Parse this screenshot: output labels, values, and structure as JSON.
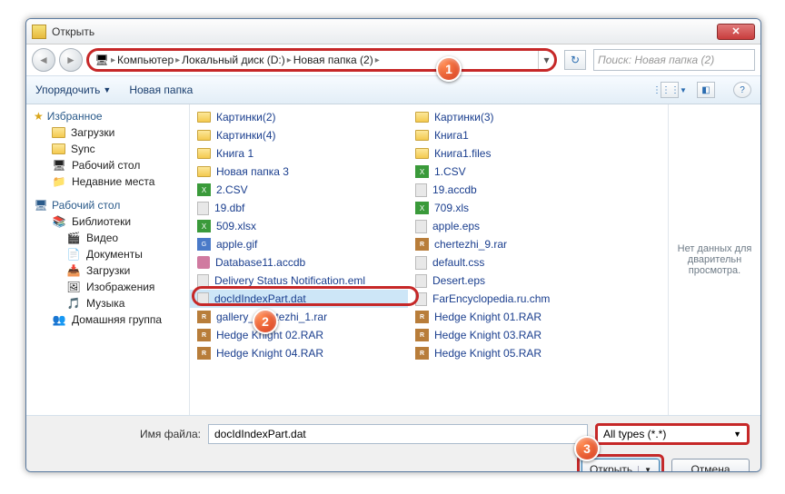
{
  "window": {
    "title": "Открыть"
  },
  "breadcrumb": [
    "Компьютер",
    "Локальный диск (D:)",
    "Новая папка (2)"
  ],
  "search": {
    "placeholder": "Поиск: Новая папка (2)"
  },
  "toolbar": {
    "organize": "Упорядочить",
    "newfolder": "Новая папка"
  },
  "sidebar": {
    "fav_header": "Избранное",
    "fav": [
      "Загрузки",
      "Sync",
      "Рабочий стол",
      "Недавние места"
    ],
    "desk_header": "Рабочий стол",
    "lib_header": "Библиотеки",
    "lib": [
      "Видео",
      "Документы",
      "Загрузки",
      "Изображения",
      "Музыка"
    ],
    "homegroup": "Домашняя группа"
  },
  "files": {
    "col1": [
      {
        "icon": "fld",
        "name": "Картинки(2)"
      },
      {
        "icon": "fld",
        "name": "Картинки(4)"
      },
      {
        "icon": "fld",
        "name": "Книга 1"
      },
      {
        "icon": "fld",
        "name": "Новая папка 3"
      },
      {
        "icon": "xls",
        "name": "2.CSV"
      },
      {
        "icon": "doc",
        "name": "19.dbf"
      },
      {
        "icon": "xls",
        "name": "509.xlsx"
      },
      {
        "icon": "gif",
        "name": "apple.gif"
      },
      {
        "icon": "db",
        "name": "Database11.accdb"
      },
      {
        "icon": "doc",
        "name": "Delivery Status Notification.eml"
      },
      {
        "icon": "doc",
        "name": "docIdIndexPart.dat",
        "selected": true
      },
      {
        "icon": "rar",
        "name": "gallery_chertezhi_1.rar"
      },
      {
        "icon": "rar",
        "name": "Hedge Knight 02.RAR"
      },
      {
        "icon": "rar",
        "name": "Hedge Knight 04.RAR"
      }
    ],
    "col2": [
      {
        "icon": "fld",
        "name": "Картинки(3)"
      },
      {
        "icon": "fld",
        "name": "Книга1"
      },
      {
        "icon": "fld",
        "name": "Книга1.files"
      },
      {
        "icon": "xls",
        "name": "1.CSV"
      },
      {
        "icon": "doc",
        "name": "19.accdb"
      },
      {
        "icon": "xls",
        "name": "709.xls"
      },
      {
        "icon": "doc",
        "name": "apple.eps"
      },
      {
        "icon": "rar",
        "name": "chertezhi_9.rar"
      },
      {
        "icon": "doc",
        "name": "default.css"
      },
      {
        "icon": "doc",
        "name": "Desert.eps"
      },
      {
        "icon": "doc",
        "name": "FarEncyclopedia.ru.chm"
      },
      {
        "icon": "rar",
        "name": "Hedge Knight 01.RAR"
      },
      {
        "icon": "rar",
        "name": "Hedge Knight 03.RAR"
      },
      {
        "icon": "rar",
        "name": "Hedge Knight 05.RAR"
      }
    ]
  },
  "preview": "Нет данных для дварительн просмотра.",
  "bottom": {
    "fname_label": "Имя файла:",
    "fname_value": "docIdIndexPart.dat",
    "types": "All types (*.*)",
    "open": "Открыть",
    "cancel": "Отмена"
  },
  "badges": {
    "b1": "1",
    "b2": "2",
    "b3": "3"
  }
}
